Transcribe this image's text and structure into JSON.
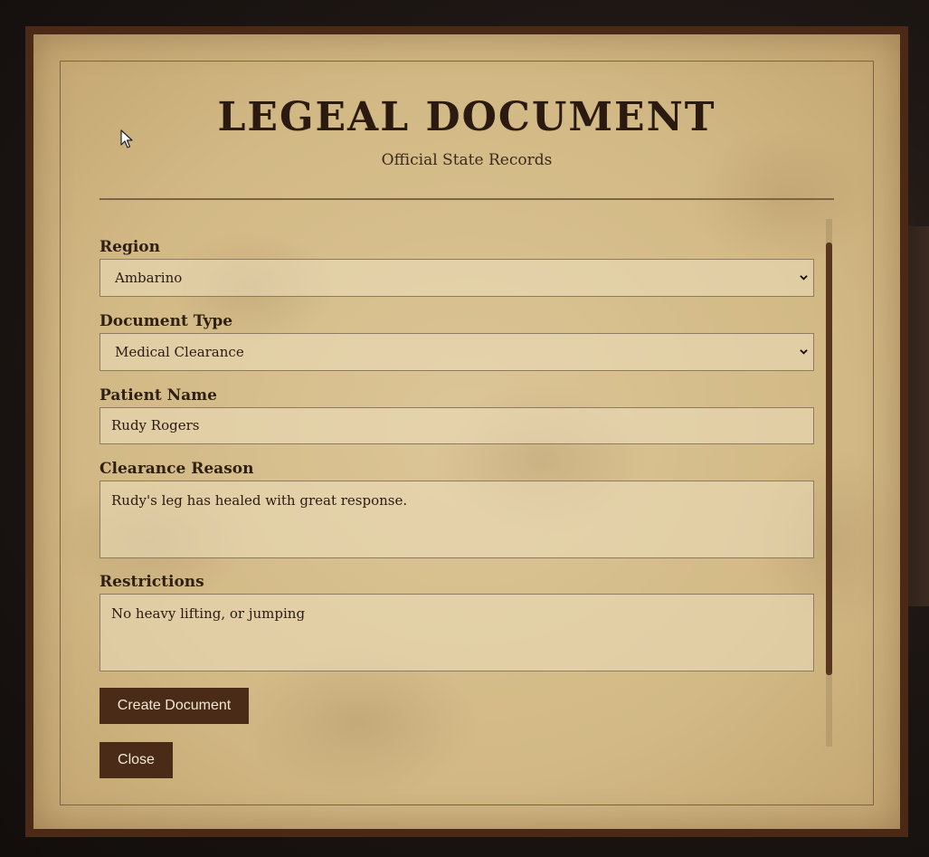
{
  "header": {
    "title": "LEGEAL DOCUMENT",
    "subtitle": "Official State Records"
  },
  "form": {
    "region": {
      "label": "Region",
      "selected": "Ambarino"
    },
    "document_type": {
      "label": "Document Type",
      "selected": "Medical Clearance"
    },
    "patient_name": {
      "label": "Patient Name",
      "value": "Rudy Rogers"
    },
    "clearance_reason": {
      "label": "Clearance Reason",
      "value": "Rudy's leg has healed with great response."
    },
    "restrictions": {
      "label": "Restrictions",
      "value": "No heavy lifting, or jumping"
    }
  },
  "buttons": {
    "create": "Create Document",
    "close": "Close"
  },
  "icons": {
    "select_chevron": "chevron-down-icon",
    "cursor": "mouse-cursor-icon"
  },
  "colors": {
    "frame": "#4a2a16",
    "paper": "#d2b985",
    "button": "#4a2b17",
    "button_text": "#f3e8d6",
    "scroll_thumb": "#5a351d"
  }
}
